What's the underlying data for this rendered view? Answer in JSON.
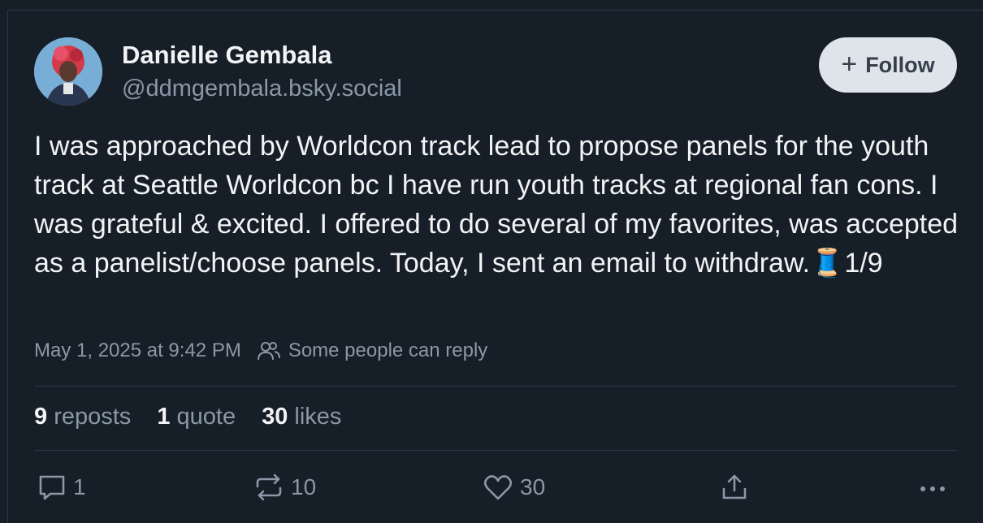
{
  "post": {
    "author_name": "Danielle Gembala",
    "author_handle": "@ddmgembala.bsky.social",
    "follow_label": "Follow",
    "text": "I was approached by Worldcon track lead to propose panels for the youth track at Seattle Worldcon bc I have run youth tracks at regional fan cons. I was grateful & excited. I offered to do several of my favorites, was accepted as a panelist/choose panels. Today, I sent an email to withdraw.🧵1/9",
    "timestamp": "May 1, 2025 at 9:42 PM",
    "reply_restriction": "Some people can reply"
  },
  "stats": {
    "reposts_count": "9",
    "reposts_label": "reposts",
    "quotes_count": "1",
    "quotes_label": "quote",
    "likes_count": "30",
    "likes_label": "likes"
  },
  "actions": {
    "reply_count": "1",
    "repost_count": "10",
    "like_count": "30",
    "icons": [
      "reply-icon",
      "repost-icon",
      "like-icon",
      "share-icon",
      "more-icon"
    ]
  },
  "colors": {
    "background": "#161e27",
    "text_primary": "#f1f3f5",
    "text_secondary": "#8b98a8",
    "divider": "#2e3a48",
    "follow_button_bg": "#dfe4ea"
  }
}
